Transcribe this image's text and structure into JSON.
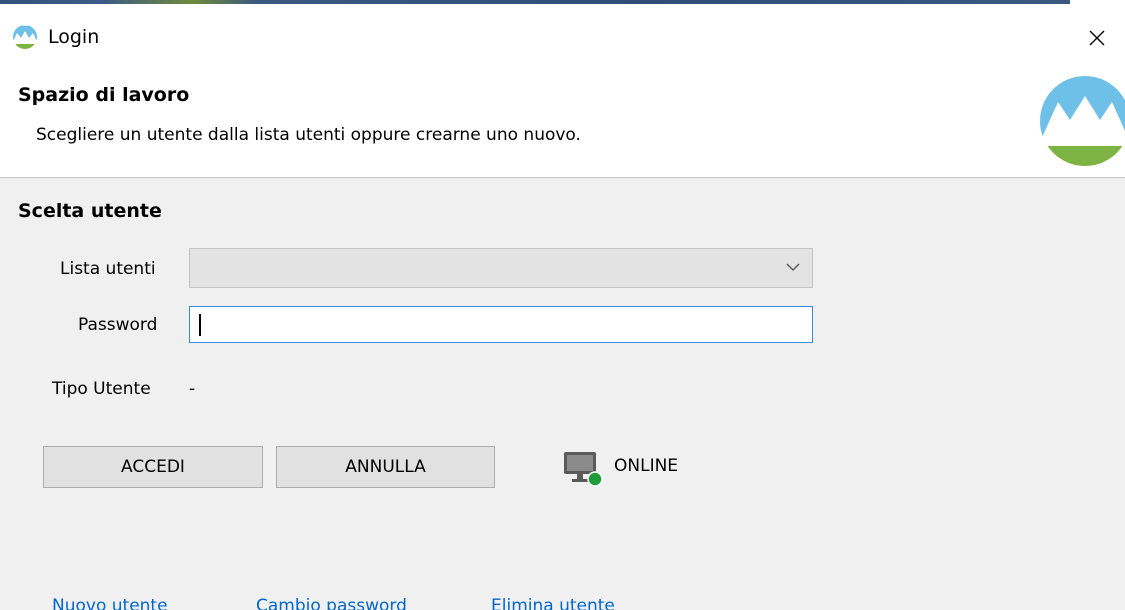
{
  "window": {
    "title": "Login",
    "icons": {
      "app": "mountain-logo-icon",
      "close": "close-icon"
    }
  },
  "header": {
    "title": "Spazio di lavoro",
    "subtitle": "Scegliere un utente dalla lista utenti oppure crearne uno nuovo.",
    "logo_icon": "mountain-logo-icon"
  },
  "form": {
    "section_title": "Scelta utente",
    "user_list_label": "Lista utenti",
    "user_list_value": "",
    "password_label": "Password",
    "password_value": "",
    "user_type_label": "Tipo Utente",
    "user_type_value": "-"
  },
  "buttons": {
    "login": "ACCEDI",
    "cancel": "ANNULLA"
  },
  "status": {
    "text": "ONLINE",
    "icon": "monitor-online-icon",
    "color": "#1e9e3a"
  },
  "links": {
    "new_user": "Nuovo utente",
    "change_password": "Cambio password",
    "delete_user": "Elimina utente"
  },
  "colors": {
    "link": "#0066cc",
    "input_focus_border": "#3b8ad8",
    "logo_sky": "#6fc0e8",
    "logo_grass": "#7cb342"
  }
}
